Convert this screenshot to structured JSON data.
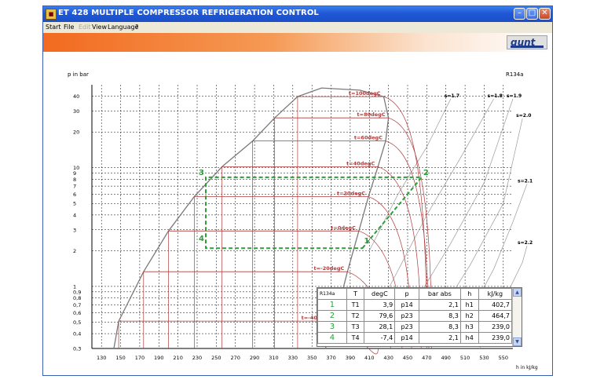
{
  "window": {
    "title": "ET 428 MULTIPLE COMPRESSOR REFRIGERATION CONTROL",
    "minimize": "–",
    "maximize": "□",
    "close": "✕"
  },
  "menu": {
    "items": [
      "Start",
      "File",
      "Edit",
      "View",
      "Language",
      "?"
    ]
  },
  "logo": {
    "text": "gunt"
  },
  "colors": {
    "isotherm": "#b03a3a",
    "cycle": "#2e9e3a",
    "saturation": "#7a7a7a",
    "isentrope": "#9a9a9a",
    "grid": "#000000"
  },
  "chart_data": {
    "type": "line",
    "title": "",
    "refrigerant": "R134a",
    "xlabel": "h in kJ/kg",
    "ylabel": "p in bar",
    "y_scale": "log",
    "grid": true,
    "xlim": [
      120,
      560
    ],
    "ylim": [
      0.3,
      50
    ],
    "x_ticks": [
      130,
      150,
      170,
      190,
      210,
      230,
      250,
      270,
      290,
      310,
      330,
      350,
      370,
      390,
      410,
      430,
      450,
      470,
      490,
      510,
      530,
      550
    ],
    "y_ticks": [
      {
        "v": 0.3,
        "label": "0,3"
      },
      {
        "v": 0.4,
        "label": "0,4"
      },
      {
        "v": 0.5,
        "label": "0,5"
      },
      {
        "v": 0.6,
        "label": "0,6"
      },
      {
        "v": 0.7,
        "label": "0,7"
      },
      {
        "v": 0.8,
        "label": "0,8"
      },
      {
        "v": 0.9,
        "label": "0,9"
      },
      {
        "v": 1,
        "label": "1"
      },
      {
        "v": 2,
        "label": "2"
      },
      {
        "v": 3,
        "label": "3"
      },
      {
        "v": 4,
        "label": "4"
      },
      {
        "v": 5,
        "label": "5"
      },
      {
        "v": 6,
        "label": "6"
      },
      {
        "v": 7,
        "label": "7"
      },
      {
        "v": 8,
        "label": "8"
      },
      {
        "v": 9,
        "label": "9"
      },
      {
        "v": 10,
        "label": "10"
      },
      {
        "v": 20,
        "label": "20"
      },
      {
        "v": 30,
        "label": "30"
      },
      {
        "v": 40,
        "label": "40"
      }
    ],
    "isotherms": [
      {
        "label": "t=100degC",
        "p": 39.7,
        "hf": 335,
        "hg": 425
      },
      {
        "label": "t=80degC",
        "p": 26.3,
        "hf": 311,
        "hg": 430
      },
      {
        "label": "t=60degC",
        "p": 16.8,
        "hf": 288,
        "hg": 427
      },
      {
        "label": "t=40degC",
        "p": 10.2,
        "hf": 256,
        "hg": 419
      },
      {
        "label": "t=20degC",
        "p": 5.7,
        "hf": 227,
        "hg": 409
      },
      {
        "label": "t=0degC",
        "p": 2.93,
        "hf": 200,
        "hg": 399
      },
      {
        "label": "t=-20degC",
        "p": 1.33,
        "hf": 174,
        "hg": 387
      },
      {
        "label": "t=-40degC",
        "p": 0.51,
        "hf": 148,
        "hg": 374
      }
    ],
    "isentropes": [
      {
        "label": "s=1.7",
        "h": [
          410,
          440,
          470,
          495
        ],
        "p": [
          2.0,
          6.0,
          15,
          38
        ]
      },
      {
        "label": "s=1.8",
        "h": [
          425,
          470,
          505,
          540
        ],
        "p": [
          0.8,
          4,
          12,
          38
        ]
      },
      {
        "label": "s=1.9",
        "h": [
          445,
          495,
          530,
          560
        ],
        "p": [
          0.5,
          2.3,
          7.5,
          38
        ]
      },
      {
        "label": "s=2.0",
        "h": [
          470,
          515,
          550,
          570
        ],
        "p": [
          0.4,
          1.5,
          5,
          26
        ]
      },
      {
        "label": "s=2.1",
        "h": [
          500,
          540,
          560,
          575
        ],
        "p": [
          0.35,
          1.4,
          3.5,
          7.3
        ]
      },
      {
        "label": "s=2.2",
        "h": [
          525,
          555,
          570,
          580
        ],
        "p": [
          0.3,
          0.9,
          1.6,
          2.2
        ]
      }
    ],
    "cycle": {
      "points": [
        {
          "id": "1",
          "h": 402.7,
          "p": 2.1
        },
        {
          "id": "2",
          "h": 464.7,
          "p": 8.3
        },
        {
          "id": "3",
          "h": 239.0,
          "p": 8.3
        },
        {
          "id": "4",
          "h": 239.0,
          "p": 2.1
        }
      ]
    },
    "saturation_dome": {
      "liquid_h": [
        143,
        148,
        174,
        200,
        227,
        256,
        288,
        311,
        335,
        360
      ],
      "liquid_p": [
        0.3,
        0.51,
        1.33,
        2.93,
        5.7,
        10.2,
        16.8,
        26.3,
        39.7,
        47
      ],
      "vapor_h": [
        364,
        374,
        387,
        399,
        409,
        419,
        427,
        430,
        425,
        400
      ],
      "vapor_p": [
        0.3,
        0.51,
        1.33,
        2.93,
        5.7,
        10.2,
        16.8,
        26.3,
        39.7,
        45
      ]
    }
  },
  "state_table": {
    "header": [
      "R134a",
      "T",
      "degC",
      "p",
      "bar abs",
      "h",
      "kJ/kg"
    ],
    "rows": [
      [
        "1",
        "T1",
        "3,9",
        "p14",
        "2,1",
        "h1",
        "402,7"
      ],
      [
        "2",
        "T2",
        "79,6",
        "p23",
        "8,3",
        "h2",
        "464,7"
      ],
      [
        "3",
        "T3",
        "28,1",
        "p23",
        "8,3",
        "h3",
        "239,0"
      ],
      [
        "4",
        "T4",
        "-7,4",
        "p14",
        "2,1",
        "h4",
        "239,0"
      ]
    ]
  }
}
